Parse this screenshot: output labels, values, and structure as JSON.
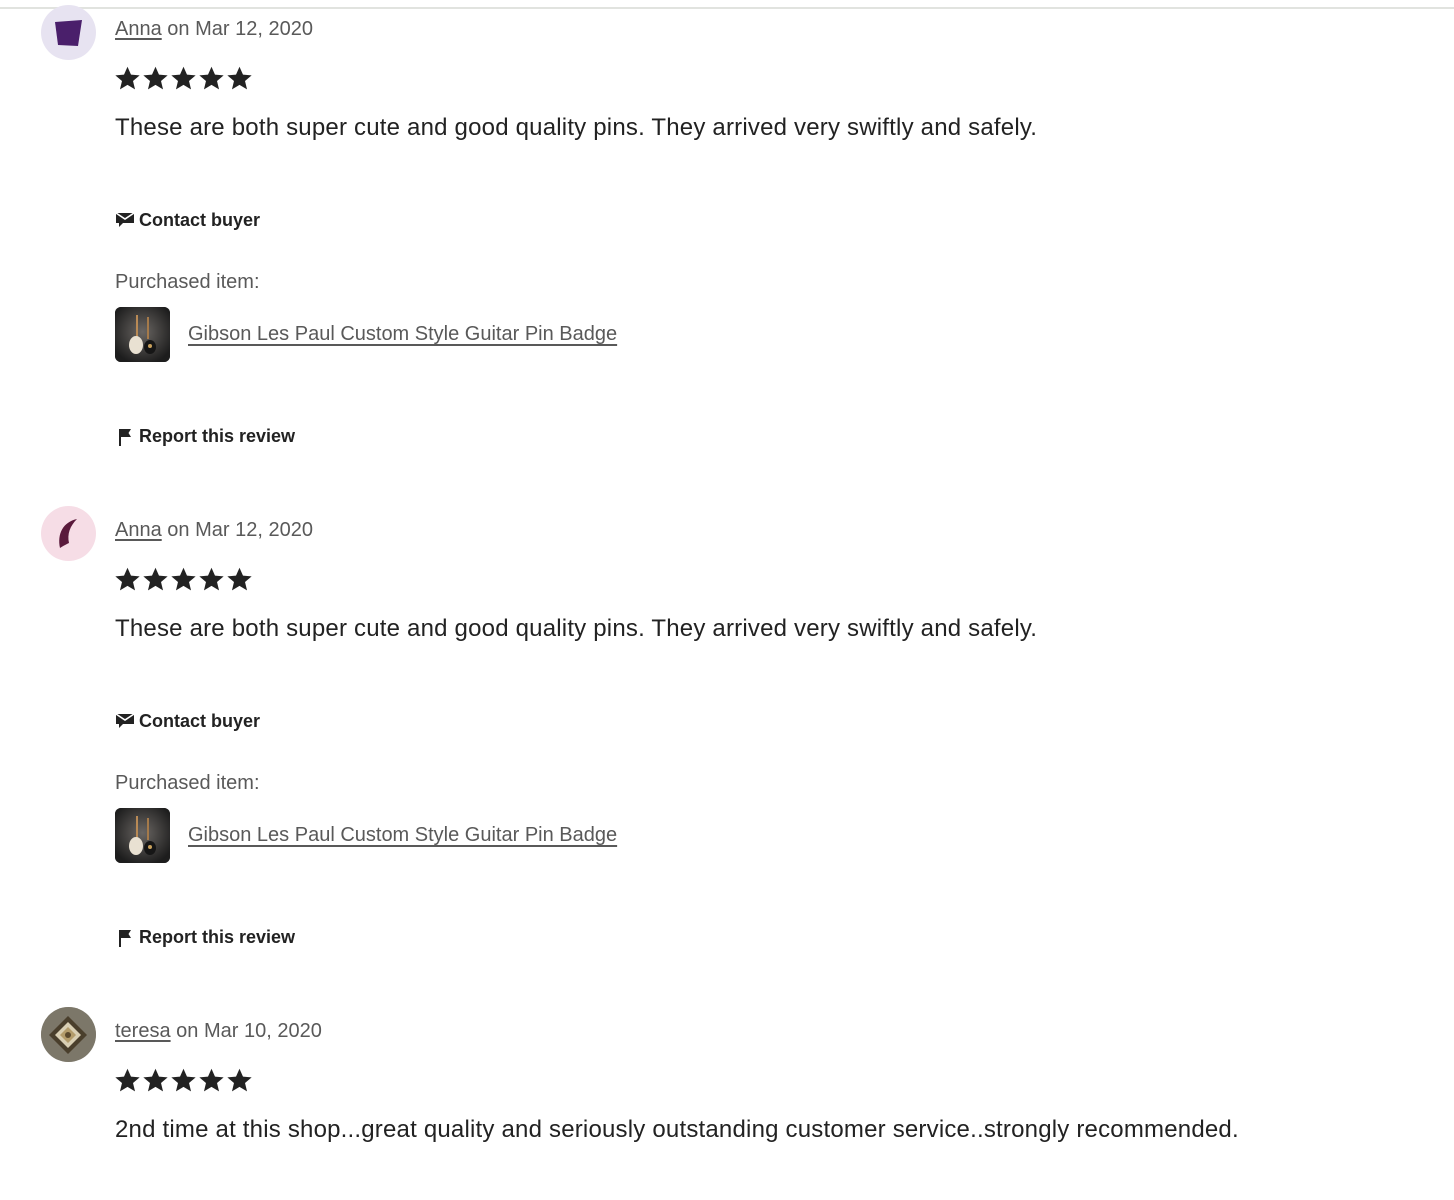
{
  "reviews": [
    {
      "reviewer": "Anna",
      "date_text": "on Mar 12, 2020",
      "rating": 5,
      "text": "These are both super cute and good quality pins. They arrived very swiftly and safely.",
      "contact_label": "Contact buyer",
      "purchased_label": "Purchased item:",
      "item_title": "Gibson Les Paul Custom Style Guitar Pin Badge",
      "report_label": "Report this review",
      "avatar_icon": "purple-square-avatar",
      "avatar_bg": "#e7e3f1",
      "avatar_color": "#4a1f6b"
    },
    {
      "reviewer": "Anna",
      "date_text": "on Mar 12, 2020",
      "rating": 5,
      "text": "These are both super cute and good quality pins. They arrived very swiftly and safely.",
      "contact_label": "Contact buyer",
      "purchased_label": "Purchased item:",
      "item_title": "Gibson Les Paul Custom Style Guitar Pin Badge",
      "report_label": "Report this review",
      "avatar_icon": "crescent-avatar",
      "avatar_bg": "#f6dde6",
      "avatar_color": "#5a1a3c"
    },
    {
      "reviewer": "teresa",
      "date_text": "on Mar 10, 2020",
      "rating": 5,
      "text": "2nd time at this shop...great quality and seriously outstanding customer service..strongly recommended.",
      "avatar_icon": "photo-avatar"
    }
  ]
}
